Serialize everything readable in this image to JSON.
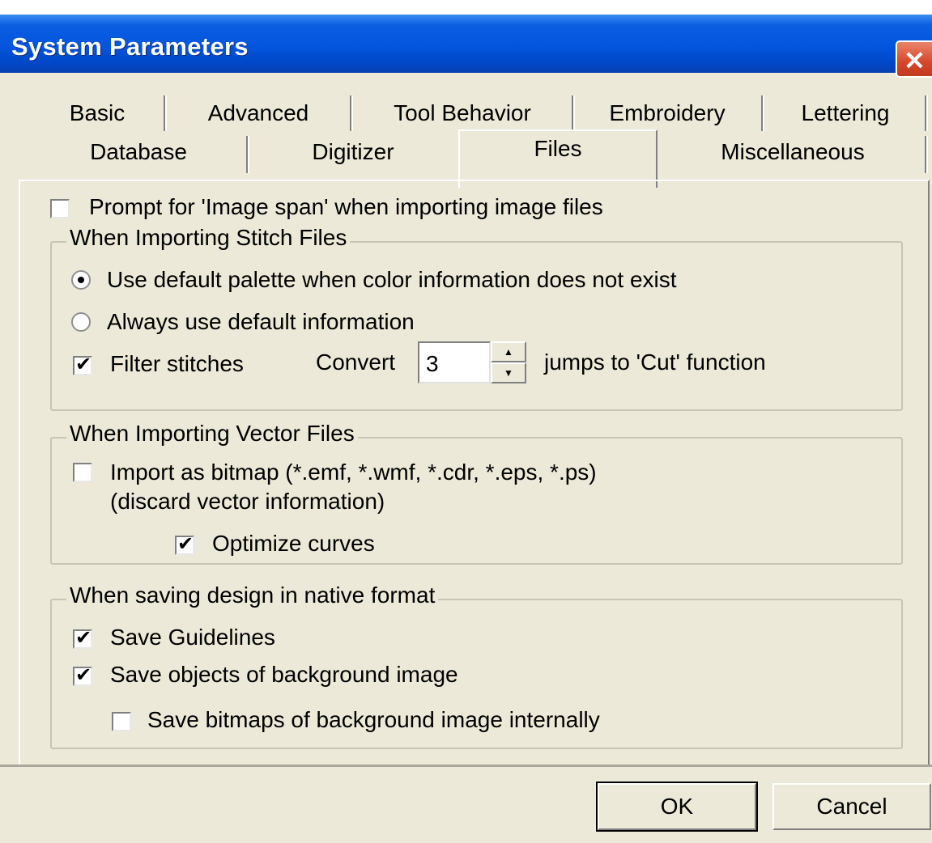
{
  "window": {
    "title": "System Parameters"
  },
  "tabs": {
    "row1": [
      "Basic",
      "Advanced",
      "Tool Behavior",
      "Embroidery",
      "Lettering"
    ],
    "row2": [
      "Database",
      "Digitizer",
      "Files",
      "Miscellaneous"
    ],
    "active": "Files"
  },
  "prompt_image_span": {
    "label": "Prompt for 'Image span' when importing image files",
    "checked": false
  },
  "stitch_group": {
    "legend": "When Importing Stitch Files",
    "radio_default_palette": {
      "label": "Use default palette when color information does not exist",
      "selected": true
    },
    "radio_always_default": {
      "label": "Always use default information",
      "selected": false
    },
    "filter_stitches": {
      "label": "Filter stitches",
      "checked": true
    },
    "convert_label": "Convert",
    "convert_value": "3",
    "jumps_label": "jumps to 'Cut' function"
  },
  "vector_group": {
    "legend": "When Importing Vector Files",
    "import_bitmap": {
      "label": "Import as bitmap (*.emf, *.wmf, *.cdr, *.eps, *.ps)",
      "label2": "(discard vector information)",
      "checked": false
    },
    "optimize_curves": {
      "label": "Optimize curves",
      "checked": true
    }
  },
  "native_group": {
    "legend": "When saving design in native format",
    "save_guidelines": {
      "label": "Save Guidelines",
      "checked": true
    },
    "save_objects_bg": {
      "label": "Save objects of background image",
      "checked": true
    },
    "save_bitmaps_bg": {
      "label": "Save bitmaps of background image internally",
      "checked": false
    }
  },
  "buttons": {
    "ok": "OK",
    "cancel": "Cancel"
  }
}
